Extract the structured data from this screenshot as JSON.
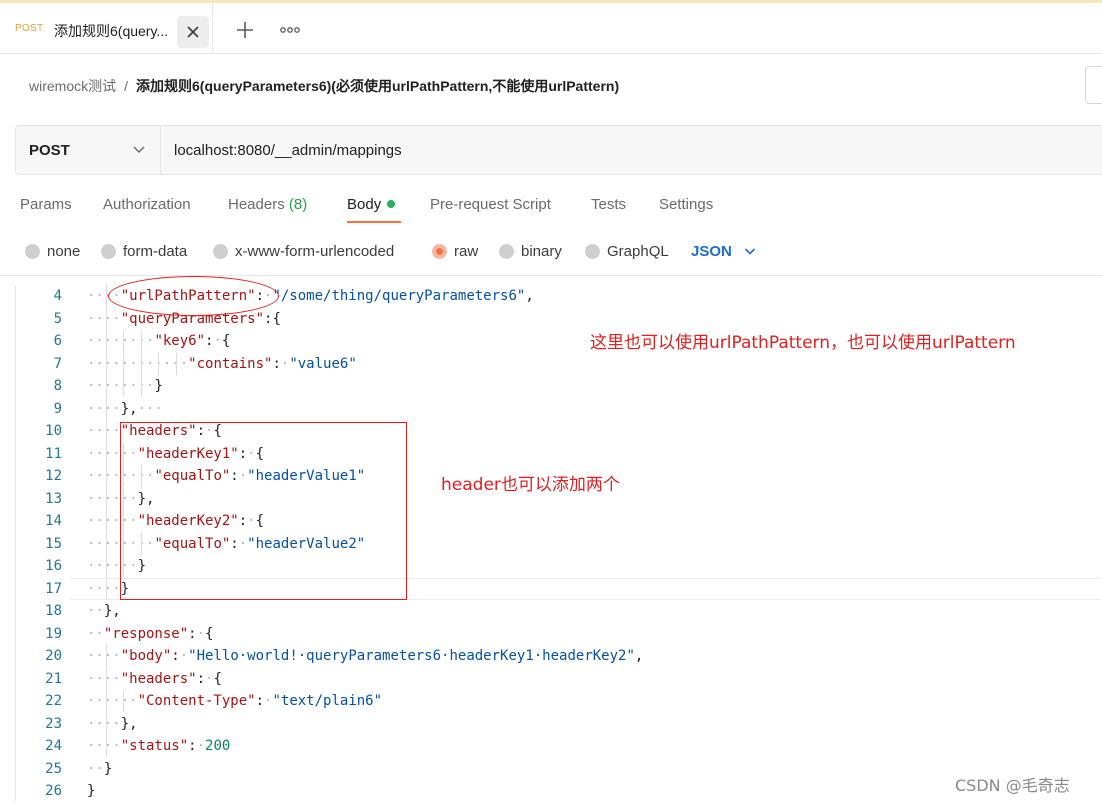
{
  "tab": {
    "method": "POST",
    "title": "添加规则6(query..."
  },
  "breadcrumb": {
    "parent": "wiremock测试",
    "separator": "/",
    "current": "添加规则6(queryParameters6)(必须使用urlPathPattern,不能使用urlPattern)"
  },
  "request": {
    "method": "POST",
    "url": "localhost:8080/__admin/mappings"
  },
  "request_tabs": {
    "params": "Params",
    "authorization": "Authorization",
    "headers": "Headers",
    "headers_count": "(8)",
    "body": "Body",
    "prerequest": "Pre-request Script",
    "tests": "Tests",
    "settings": "Settings"
  },
  "body_options": {
    "none": "none",
    "form_data": "form-data",
    "urlencoded": "x-www-form-urlencoded",
    "raw": "raw",
    "binary": "binary",
    "graphql": "GraphQL",
    "format": "JSON"
  },
  "editor": {
    "lines": [
      {
        "n": "4",
        "i": 2,
        "t": [
          [
            "k",
            "\"urlPathPattern\""
          ],
          [
            "p",
            ":"
          ],
          [
            "w",
            "·"
          ],
          [
            "s",
            "\"/some/thing/queryParameters6\""
          ],
          [
            "p",
            ","
          ]
        ]
      },
      {
        "n": "5",
        "i": 2,
        "t": [
          [
            "k",
            "\"queryParameters\""
          ],
          [
            "p",
            ":{"
          ]
        ]
      },
      {
        "n": "6",
        "i": 4,
        "t": [
          [
            "k",
            "\"key6\""
          ],
          [
            "p",
            ":"
          ],
          [
            "w",
            "·"
          ],
          [
            "p",
            "{"
          ]
        ]
      },
      {
        "n": "7",
        "i": 6,
        "t": [
          [
            "k",
            "\"contains\""
          ],
          [
            "p",
            ":"
          ],
          [
            "w",
            "·"
          ],
          [
            "s",
            "\"value6\""
          ]
        ]
      },
      {
        "n": "8",
        "i": 4,
        "t": [
          [
            "p",
            "}"
          ]
        ]
      },
      {
        "n": "9",
        "i": 2,
        "t": [
          [
            "p",
            "},"
          ],
          [
            "w",
            "···"
          ]
        ]
      },
      {
        "n": "10",
        "i": 2,
        "t": [
          [
            "k",
            "\"headers\""
          ],
          [
            "p",
            ":"
          ],
          [
            "w",
            "·"
          ],
          [
            "p",
            "{"
          ]
        ]
      },
      {
        "n": "11",
        "i": 3,
        "t": [
          [
            "k",
            "\"headerKey1\""
          ],
          [
            "p",
            ":"
          ],
          [
            "w",
            "·"
          ],
          [
            "p",
            "{"
          ]
        ]
      },
      {
        "n": "12",
        "i": 4,
        "t": [
          [
            "k",
            "\"equalTo\""
          ],
          [
            "p",
            ":"
          ],
          [
            "w",
            "·"
          ],
          [
            "s",
            "\"headerValue1\""
          ]
        ]
      },
      {
        "n": "13",
        "i": 3,
        "t": [
          [
            "p",
            "},"
          ]
        ]
      },
      {
        "n": "14",
        "i": 3,
        "t": [
          [
            "k",
            "\"headerKey2\""
          ],
          [
            "p",
            ":"
          ],
          [
            "w",
            "·"
          ],
          [
            "p",
            "{"
          ]
        ]
      },
      {
        "n": "15",
        "i": 4,
        "t": [
          [
            "k",
            "\"equalTo\""
          ],
          [
            "p",
            ":"
          ],
          [
            "w",
            "·"
          ],
          [
            "s",
            "\"headerValue2\""
          ]
        ]
      },
      {
        "n": "16",
        "i": 3,
        "t": [
          [
            "p",
            "}"
          ]
        ]
      },
      {
        "n": "17",
        "i": 2,
        "t": [
          [
            "p",
            "}"
          ]
        ]
      },
      {
        "n": "18",
        "i": 1,
        "t": [
          [
            "p",
            "},"
          ]
        ]
      },
      {
        "n": "19",
        "i": 1,
        "t": [
          [
            "k",
            "\"response\""
          ],
          [
            "p",
            ":"
          ],
          [
            "w",
            "·"
          ],
          [
            "p",
            "{"
          ]
        ]
      },
      {
        "n": "20",
        "i": 2,
        "t": [
          [
            "k",
            "\"body\""
          ],
          [
            "p",
            ":"
          ],
          [
            "w",
            "·"
          ],
          [
            "s",
            "\"Hello·world!·queryParameters6·headerKey1·headerKey2\""
          ],
          [
            "p",
            ","
          ]
        ]
      },
      {
        "n": "21",
        "i": 2,
        "t": [
          [
            "k",
            "\"headers\""
          ],
          [
            "p",
            ":"
          ],
          [
            "w",
            "·"
          ],
          [
            "p",
            "{"
          ]
        ]
      },
      {
        "n": "22",
        "i": 3,
        "t": [
          [
            "k",
            "\"Content-Type\""
          ],
          [
            "p",
            ":"
          ],
          [
            "w",
            "·"
          ],
          [
            "s",
            "\"text/plain6\""
          ]
        ]
      },
      {
        "n": "23",
        "i": 2,
        "t": [
          [
            "p",
            "},"
          ]
        ]
      },
      {
        "n": "24",
        "i": 2,
        "t": [
          [
            "k",
            "\"status\""
          ],
          [
            "p",
            ":"
          ],
          [
            "w",
            "·"
          ],
          [
            "n",
            "200"
          ]
        ]
      },
      {
        "n": "25",
        "i": 1,
        "t": [
          [
            "p",
            "}"
          ]
        ]
      },
      {
        "n": "26",
        "i": 0,
        "t": [
          [
            "p",
            "}"
          ]
        ]
      }
    ]
  },
  "annotations": {
    "note1": "这里也可以使用urlPathPattern，也可以使用urlPattern",
    "note2": "header也可以添加两个"
  },
  "watermark": "CSDN @毛奇志",
  "colors": {
    "accent": "#ff6c37",
    "method_tab": "#e2a23b",
    "link_blue": "#1f6bd0",
    "annotation_red": "#e02020",
    "json_key": "#a31515",
    "json_string": "#0451a5",
    "json_number": "#098658",
    "line_number": "#237893"
  }
}
